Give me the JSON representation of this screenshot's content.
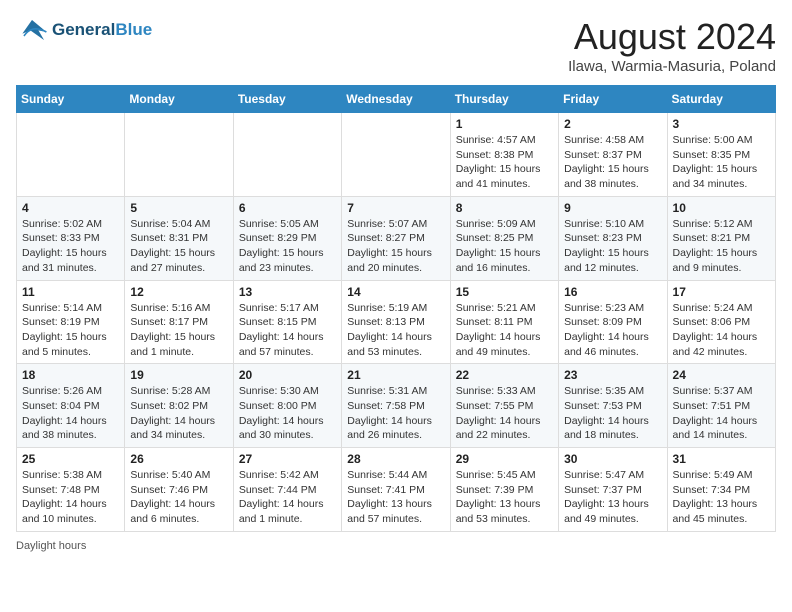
{
  "header": {
    "logo_line1": "General",
    "logo_line2": "Blue",
    "month_title": "August 2024",
    "location": "Ilawa, Warmia-Masuria, Poland"
  },
  "days_of_week": [
    "Sunday",
    "Monday",
    "Tuesday",
    "Wednesday",
    "Thursday",
    "Friday",
    "Saturday"
  ],
  "weeks": [
    [
      {
        "day": "",
        "info": ""
      },
      {
        "day": "",
        "info": ""
      },
      {
        "day": "",
        "info": ""
      },
      {
        "day": "",
        "info": ""
      },
      {
        "day": "1",
        "info": "Sunrise: 4:57 AM\nSunset: 8:38 PM\nDaylight: 15 hours and 41 minutes."
      },
      {
        "day": "2",
        "info": "Sunrise: 4:58 AM\nSunset: 8:37 PM\nDaylight: 15 hours and 38 minutes."
      },
      {
        "day": "3",
        "info": "Sunrise: 5:00 AM\nSunset: 8:35 PM\nDaylight: 15 hours and 34 minutes."
      }
    ],
    [
      {
        "day": "4",
        "info": "Sunrise: 5:02 AM\nSunset: 8:33 PM\nDaylight: 15 hours and 31 minutes."
      },
      {
        "day": "5",
        "info": "Sunrise: 5:04 AM\nSunset: 8:31 PM\nDaylight: 15 hours and 27 minutes."
      },
      {
        "day": "6",
        "info": "Sunrise: 5:05 AM\nSunset: 8:29 PM\nDaylight: 15 hours and 23 minutes."
      },
      {
        "day": "7",
        "info": "Sunrise: 5:07 AM\nSunset: 8:27 PM\nDaylight: 15 hours and 20 minutes."
      },
      {
        "day": "8",
        "info": "Sunrise: 5:09 AM\nSunset: 8:25 PM\nDaylight: 15 hours and 16 minutes."
      },
      {
        "day": "9",
        "info": "Sunrise: 5:10 AM\nSunset: 8:23 PM\nDaylight: 15 hours and 12 minutes."
      },
      {
        "day": "10",
        "info": "Sunrise: 5:12 AM\nSunset: 8:21 PM\nDaylight: 15 hours and 9 minutes."
      }
    ],
    [
      {
        "day": "11",
        "info": "Sunrise: 5:14 AM\nSunset: 8:19 PM\nDaylight: 15 hours and 5 minutes."
      },
      {
        "day": "12",
        "info": "Sunrise: 5:16 AM\nSunset: 8:17 PM\nDaylight: 15 hours and 1 minute."
      },
      {
        "day": "13",
        "info": "Sunrise: 5:17 AM\nSunset: 8:15 PM\nDaylight: 14 hours and 57 minutes."
      },
      {
        "day": "14",
        "info": "Sunrise: 5:19 AM\nSunset: 8:13 PM\nDaylight: 14 hours and 53 minutes."
      },
      {
        "day": "15",
        "info": "Sunrise: 5:21 AM\nSunset: 8:11 PM\nDaylight: 14 hours and 49 minutes."
      },
      {
        "day": "16",
        "info": "Sunrise: 5:23 AM\nSunset: 8:09 PM\nDaylight: 14 hours and 46 minutes."
      },
      {
        "day": "17",
        "info": "Sunrise: 5:24 AM\nSunset: 8:06 PM\nDaylight: 14 hours and 42 minutes."
      }
    ],
    [
      {
        "day": "18",
        "info": "Sunrise: 5:26 AM\nSunset: 8:04 PM\nDaylight: 14 hours and 38 minutes."
      },
      {
        "day": "19",
        "info": "Sunrise: 5:28 AM\nSunset: 8:02 PM\nDaylight: 14 hours and 34 minutes."
      },
      {
        "day": "20",
        "info": "Sunrise: 5:30 AM\nSunset: 8:00 PM\nDaylight: 14 hours and 30 minutes."
      },
      {
        "day": "21",
        "info": "Sunrise: 5:31 AM\nSunset: 7:58 PM\nDaylight: 14 hours and 26 minutes."
      },
      {
        "day": "22",
        "info": "Sunrise: 5:33 AM\nSunset: 7:55 PM\nDaylight: 14 hours and 22 minutes."
      },
      {
        "day": "23",
        "info": "Sunrise: 5:35 AM\nSunset: 7:53 PM\nDaylight: 14 hours and 18 minutes."
      },
      {
        "day": "24",
        "info": "Sunrise: 5:37 AM\nSunset: 7:51 PM\nDaylight: 14 hours and 14 minutes."
      }
    ],
    [
      {
        "day": "25",
        "info": "Sunrise: 5:38 AM\nSunset: 7:48 PM\nDaylight: 14 hours and 10 minutes."
      },
      {
        "day": "26",
        "info": "Sunrise: 5:40 AM\nSunset: 7:46 PM\nDaylight: 14 hours and 6 minutes."
      },
      {
        "day": "27",
        "info": "Sunrise: 5:42 AM\nSunset: 7:44 PM\nDaylight: 14 hours and 1 minute."
      },
      {
        "day": "28",
        "info": "Sunrise: 5:44 AM\nSunset: 7:41 PM\nDaylight: 13 hours and 57 minutes."
      },
      {
        "day": "29",
        "info": "Sunrise: 5:45 AM\nSunset: 7:39 PM\nDaylight: 13 hours and 53 minutes."
      },
      {
        "day": "30",
        "info": "Sunrise: 5:47 AM\nSunset: 7:37 PM\nDaylight: 13 hours and 49 minutes."
      },
      {
        "day": "31",
        "info": "Sunrise: 5:49 AM\nSunset: 7:34 PM\nDaylight: 13 hours and 45 minutes."
      }
    ]
  ],
  "footer": {
    "daylight_label": "Daylight hours"
  }
}
